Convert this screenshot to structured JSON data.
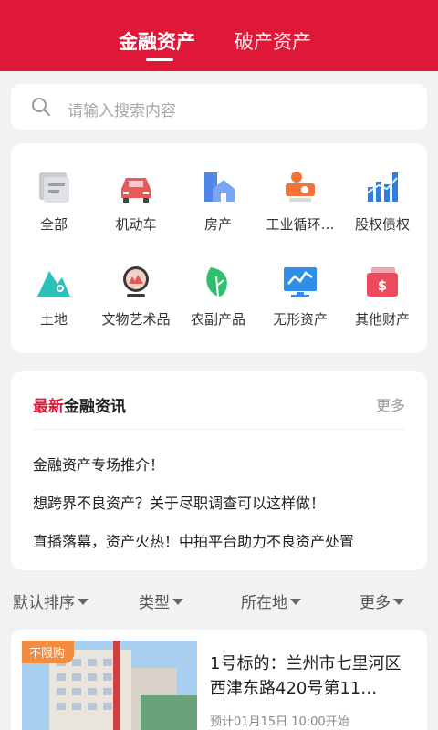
{
  "header": {
    "tabs": [
      {
        "label": "金融资产",
        "active": true
      },
      {
        "label": "破产资产",
        "active": false
      }
    ],
    "color": "#e01838"
  },
  "search": {
    "placeholder": "请输入搜索内容"
  },
  "categories": [
    {
      "label": "全部",
      "icon": "all-doc-icon"
    },
    {
      "label": "机动车",
      "icon": "car-icon"
    },
    {
      "label": "房产",
      "icon": "house-icon"
    },
    {
      "label": "工业循环…",
      "icon": "industrial-machine-icon"
    },
    {
      "label": "股权债权",
      "icon": "equity-bars-icon"
    },
    {
      "label": "土地",
      "icon": "land-mountain-icon"
    },
    {
      "label": "文物艺术品",
      "icon": "artwork-icon"
    },
    {
      "label": "农副产品",
      "icon": "leaf-icon"
    },
    {
      "label": "无形资产",
      "icon": "monitor-chart-icon"
    },
    {
      "label": "其他财产",
      "icon": "money-wallet-icon"
    }
  ],
  "news": {
    "title_highlight": "最新",
    "title_rest": "金融资讯",
    "more_label": "更多",
    "items": [
      "金融资产专场推介！",
      "想跨界不良资产？关于尽职调查可以这样做！",
      "直播落幕，资产火热！中拍平台助力不良资产处置"
    ]
  },
  "filters": [
    {
      "label": "默认排序"
    },
    {
      "label": "类型"
    },
    {
      "label": "所在地"
    },
    {
      "label": "更多"
    }
  ],
  "listing": {
    "tag": "不限购",
    "title": "1号标的：兰州市七里河区西津东路420号第11…",
    "meta": "预计01月15日 10:00开始"
  }
}
